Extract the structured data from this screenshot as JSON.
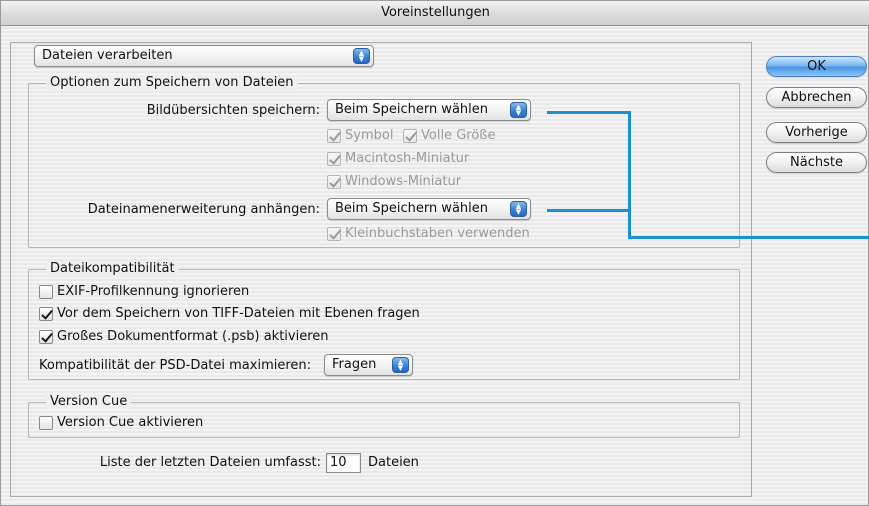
{
  "window": {
    "title": "Voreinstellungen"
  },
  "category_popup": {
    "value": "Dateien verarbeiten"
  },
  "save_options": {
    "title": "Optionen zum Speichern von Dateien",
    "preview_label": "Bildübersichten speichern:",
    "preview_popup": "Beim Speichern wählen",
    "symbol": {
      "label": "Symbol",
      "checked": true,
      "enabled": false
    },
    "full_size": {
      "label": "Volle Größe",
      "checked": true,
      "enabled": false
    },
    "mac_thumb": {
      "label": "Macintosh-Miniatur",
      "checked": true,
      "enabled": false
    },
    "win_thumb": {
      "label": "Windows-Miniatur",
      "checked": true,
      "enabled": false
    },
    "extension_label": "Dateinamenerweiterung anhängen:",
    "extension_popup": "Beim Speichern wählen",
    "lowercase": {
      "label": "Kleinbuchstaben verwenden",
      "checked": true,
      "enabled": false
    }
  },
  "compatibility": {
    "title": "Dateikompatibilität",
    "exif": {
      "label": "EXIF-Profilkennung ignorieren",
      "checked": false
    },
    "tiff": {
      "label": "Vor dem Speichern von TIFF-Dateien mit Ebenen fragen",
      "checked": true
    },
    "psb": {
      "label": "Großes Dokumentformat (.psb) aktivieren",
      "checked": true
    },
    "psd_label": "Kompatibilität der PSD-Datei maximieren:",
    "psd_popup": "Fragen"
  },
  "version_cue": {
    "title": "Version Cue",
    "enable": {
      "label": "Version Cue aktivieren",
      "checked": false
    }
  },
  "recent_files": {
    "label": "Liste der letzten Dateien umfasst:",
    "value": "10",
    "suffix": "Dateien"
  },
  "buttons": {
    "ok": "OK",
    "cancel": "Abbrechen",
    "previous": "Vorherige",
    "next": "Nächste"
  },
  "colors": {
    "callout": "#1a8fd1",
    "default_button": "#4a95e4"
  }
}
